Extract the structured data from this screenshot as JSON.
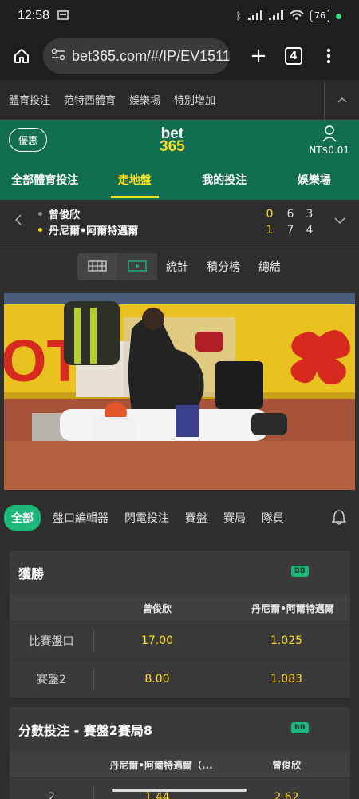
{
  "status": {
    "time": "12:58",
    "battery": "76"
  },
  "browser": {
    "url": "bet365.com/#/IP/EV1511",
    "tab_count": "4"
  },
  "topnav": {
    "items": [
      "體育投注",
      "范特西體育",
      "娛樂場",
      "特別增加"
    ]
  },
  "header": {
    "promo_label": "優惠",
    "logo_line1": "bet",
    "logo_line2": "365",
    "balance": "NT$0.01",
    "tabs": [
      "全部體育投注",
      "走地盤",
      "我的投注",
      "娛樂場"
    ]
  },
  "match": {
    "players": [
      {
        "name": "曾俊欣",
        "sets": [
          "0",
          "6",
          "3"
        ]
      },
      {
        "name": "丹尼爾•阿爾特邁爾",
        "sets": [
          "1",
          "7",
          "4"
        ]
      }
    ]
  },
  "media": {
    "links": [
      "統計",
      "積分榜",
      "總結"
    ]
  },
  "filters": {
    "items": [
      "全部",
      "盤口編輯器",
      "閃電投注",
      "賽盤",
      "賽局",
      "隊員"
    ]
  },
  "markets": [
    {
      "title": "獲勝",
      "badge": "BB",
      "columns": [
        "曾俊欣",
        "丹尼爾•阿爾特邁爾"
      ],
      "rows": [
        {
          "label": "比賽盤口",
          "odds": [
            "17.00",
            "1.025"
          ]
        },
        {
          "label": "賽盤2",
          "odds": [
            "8.00",
            "1.083"
          ]
        }
      ]
    },
    {
      "title": "分數投注 - 賽盤2賽局8",
      "badge": "BB",
      "columns": [
        "丹尼爾•阿爾特邁爾（...",
        "曾俊欣"
      ],
      "rows": [
        {
          "label": "2",
          "odds": [
            "1.44",
            "2.62"
          ]
        }
      ]
    }
  ],
  "colors": {
    "brand_green": "#126e51",
    "accent_yellow": "#ffdf1b",
    "chip_green": "#1db77a"
  }
}
